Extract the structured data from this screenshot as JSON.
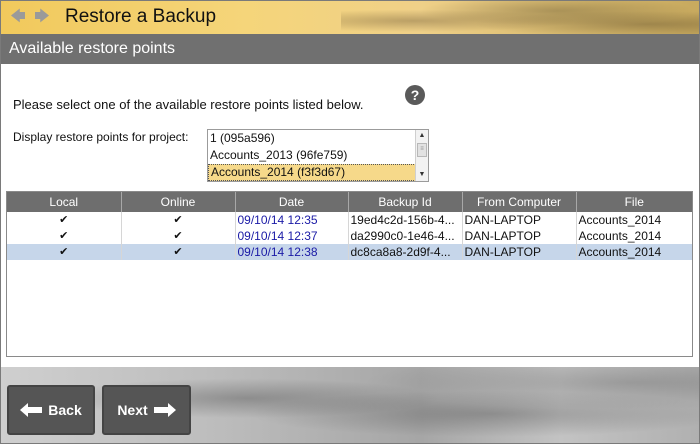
{
  "window": {
    "title": "Restore a Backup",
    "nav_back_icon": "back-arrow-icon",
    "nav_forward_icon": "forward-arrow-icon"
  },
  "section": {
    "header": "Available restore points"
  },
  "instruction": "Please select one of the available restore points listed below.",
  "help_icon": "?",
  "project_picker": {
    "label": "Display restore points for project:",
    "items": [
      "1 (095a596)",
      "Accounts_2013 (96fe759)",
      "Accounts_2014 (f3f3d67)"
    ],
    "selected_index": 2
  },
  "table": {
    "headers": [
      "Local",
      "Online",
      "Date",
      "Backup Id",
      "From Computer",
      "File"
    ],
    "rows": [
      {
        "local": "✔",
        "online": "✔",
        "date": "09/10/14 12:35",
        "backup_id": "19ed4c2d-156b-4...",
        "computer": "DAN-LAPTOP",
        "file": "Accounts_2014"
      },
      {
        "local": "✔",
        "online": "✔",
        "date": "09/10/14 12:37",
        "backup_id": "da2990c0-1e46-4...",
        "computer": "DAN-LAPTOP",
        "file": "Accounts_2014"
      },
      {
        "local": "✔",
        "online": "✔",
        "date": "09/10/14 12:38",
        "backup_id": "dc8ca8a8-2d9f-4...",
        "computer": "DAN-LAPTOP",
        "file": "Accounts_2014"
      }
    ],
    "selected_row": 2
  },
  "buttons": {
    "back": "Back",
    "next": "Next"
  },
  "colors": {
    "title_bar": "#f1c95c",
    "section_header": "#707070",
    "table_header": "#6e6e6e",
    "selected_row": "#c6d6ea",
    "selected_project": "#f6d98a",
    "date_text": "#1a1aa6",
    "button": "#555555"
  }
}
